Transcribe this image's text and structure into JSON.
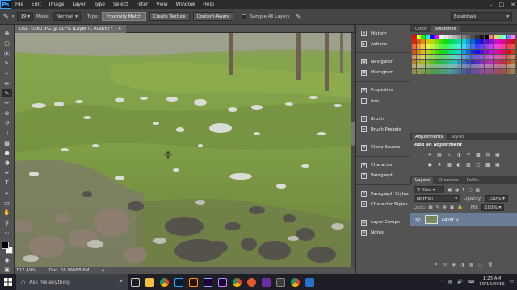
{
  "app": {
    "logo": "Ps"
  },
  "menu": [
    "File",
    "Edit",
    "Image",
    "Layer",
    "Type",
    "Select",
    "Filter",
    "View",
    "Window",
    "Help"
  ],
  "options": {
    "mode_label": "Mode:",
    "mode_value": "Normal",
    "type_label": "Type:",
    "btn_proximity": "Proximity Match",
    "btn_texture": "Create Texture",
    "btn_content": "Content-Aware",
    "sample_all": "Sample All Layers",
    "brush_size": "19",
    "workspace": "Essentials"
  },
  "document": {
    "tab_title": "DSC_0380.JPG @ 117% (Layer 0, RGB/8) *",
    "zoom": "117.49%",
    "doc_size": "Doc: 68.8M/68.8M"
  },
  "mid_panel": {
    "groups": [
      [
        "History",
        "Actions"
      ],
      [
        "Navigator",
        "Histogram"
      ],
      [
        "Properties",
        "Info"
      ],
      [
        "Brush",
        "Brush Presets"
      ],
      [
        "Clone Source"
      ],
      [
        "Character",
        "Paragraph"
      ],
      [
        "Paragraph Styles",
        "Character Styles"
      ],
      [
        "Layer Comps",
        "Notes"
      ]
    ]
  },
  "color_panel": {
    "tabs": [
      "Color",
      "Swatches"
    ],
    "active": "Swatches"
  },
  "adjustments": {
    "tabs": [
      "Adjustments",
      "Styles"
    ],
    "title": "Add an adjustment"
  },
  "layers": {
    "tabs": [
      "Layers",
      "Channels",
      "Paths"
    ],
    "kind": "Kind",
    "blend": "Normal",
    "opacity_label": "Opacity:",
    "opacity": "100%",
    "lock_label": "Lock:",
    "fill_label": "Fill:",
    "fill": "100%",
    "layer_name": "Layer 0"
  },
  "taskbar": {
    "search": "Ask me anything",
    "time": "1:23 AM",
    "date": "10/12/2016"
  }
}
